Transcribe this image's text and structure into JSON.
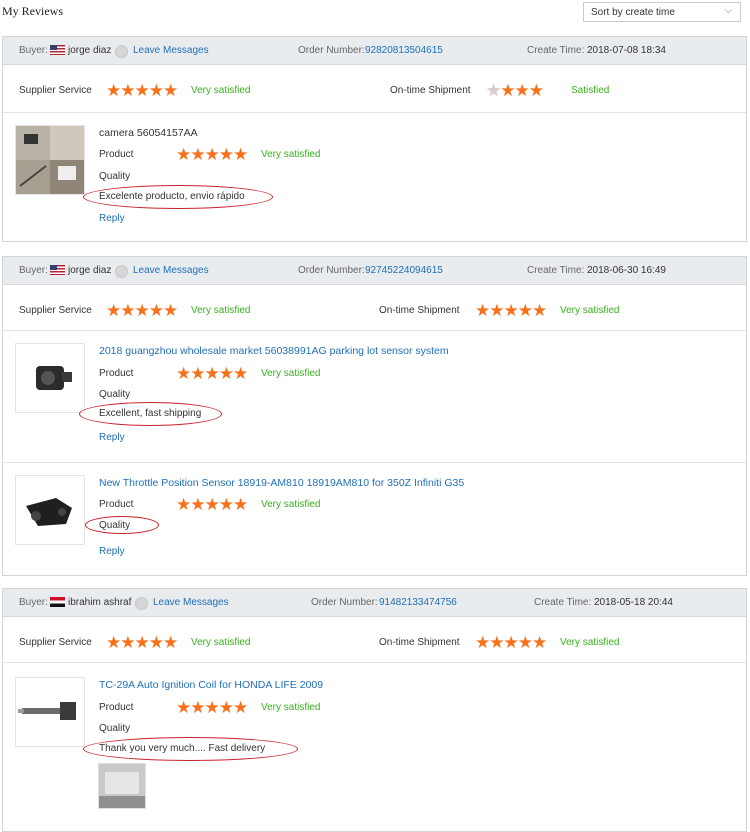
{
  "page": {
    "title": "My Reviews",
    "sort_label": "Sort by create time"
  },
  "labels": {
    "buyer": "Buyer:",
    "leave_messages": "Leave Messages",
    "order_number": "Order Number:",
    "create_time": "Create Time:",
    "supplier_service": "Supplier Service",
    "on_time_shipment": "On-time Shipment",
    "product": "Product",
    "quality": "Quality",
    "reply": "Reply"
  },
  "colors": {
    "accent_blue": "#1f6fb7",
    "star_orange": "#f7701b",
    "positive_green": "#3ab01f",
    "highlight_red": "#c8232b",
    "header_bg": "#e9ecef"
  },
  "reviews": [
    {
      "buyer": "jorge diaz",
      "flag": "us-flag-icon",
      "order_number": "92820813504615",
      "create_time": "2018-07-08 18:34",
      "supplier_service": {
        "stars": 5,
        "text": "Very satisfied"
      },
      "on_time_shipment": {
        "stars": 4,
        "text": "Satisfied"
      },
      "products": [
        {
          "name": "camera 56054157AA",
          "product_stars": 5,
          "product_text": "Very satisfied",
          "comment": "Excelente producto, envio rápido"
        }
      ]
    },
    {
      "buyer": "jorge diaz",
      "flag": "us-flag-icon",
      "order_number": "92745224094615",
      "create_time": "2018-06-30 16:49",
      "supplier_service": {
        "stars": 5,
        "text": "Very satisfied"
      },
      "on_time_shipment": {
        "stars": 5,
        "text": "Very satisfied"
      },
      "products": [
        {
          "name": "2018 guangzhou wholesale market 56038991AG parking lot sensor system",
          "product_stars": 5,
          "product_text": "Very satisfied",
          "comment": "Excellent, fast shipping"
        },
        {
          "name": "New Throttle Position Sensor 18919-AM810 18919AM810 for 350Z Infiniti G35",
          "product_stars": 5,
          "product_text": "Very satisfied",
          "comment": ""
        }
      ]
    },
    {
      "buyer": "ibrahim ashraf",
      "flag": "eg-flag-icon",
      "order_number": "91482133474756",
      "create_time": "2018-05-18 20:44",
      "supplier_service": {
        "stars": 5,
        "text": "Very satisfied"
      },
      "on_time_shipment": {
        "stars": 5,
        "text": "Very satisfied"
      },
      "products": [
        {
          "name": "TC-29A Auto Ignition Coil for HONDA LIFE 2009",
          "product_stars": 5,
          "product_text": "Very satisfied",
          "comment": "Thank you very much.... Fast delivery"
        }
      ]
    }
  ]
}
